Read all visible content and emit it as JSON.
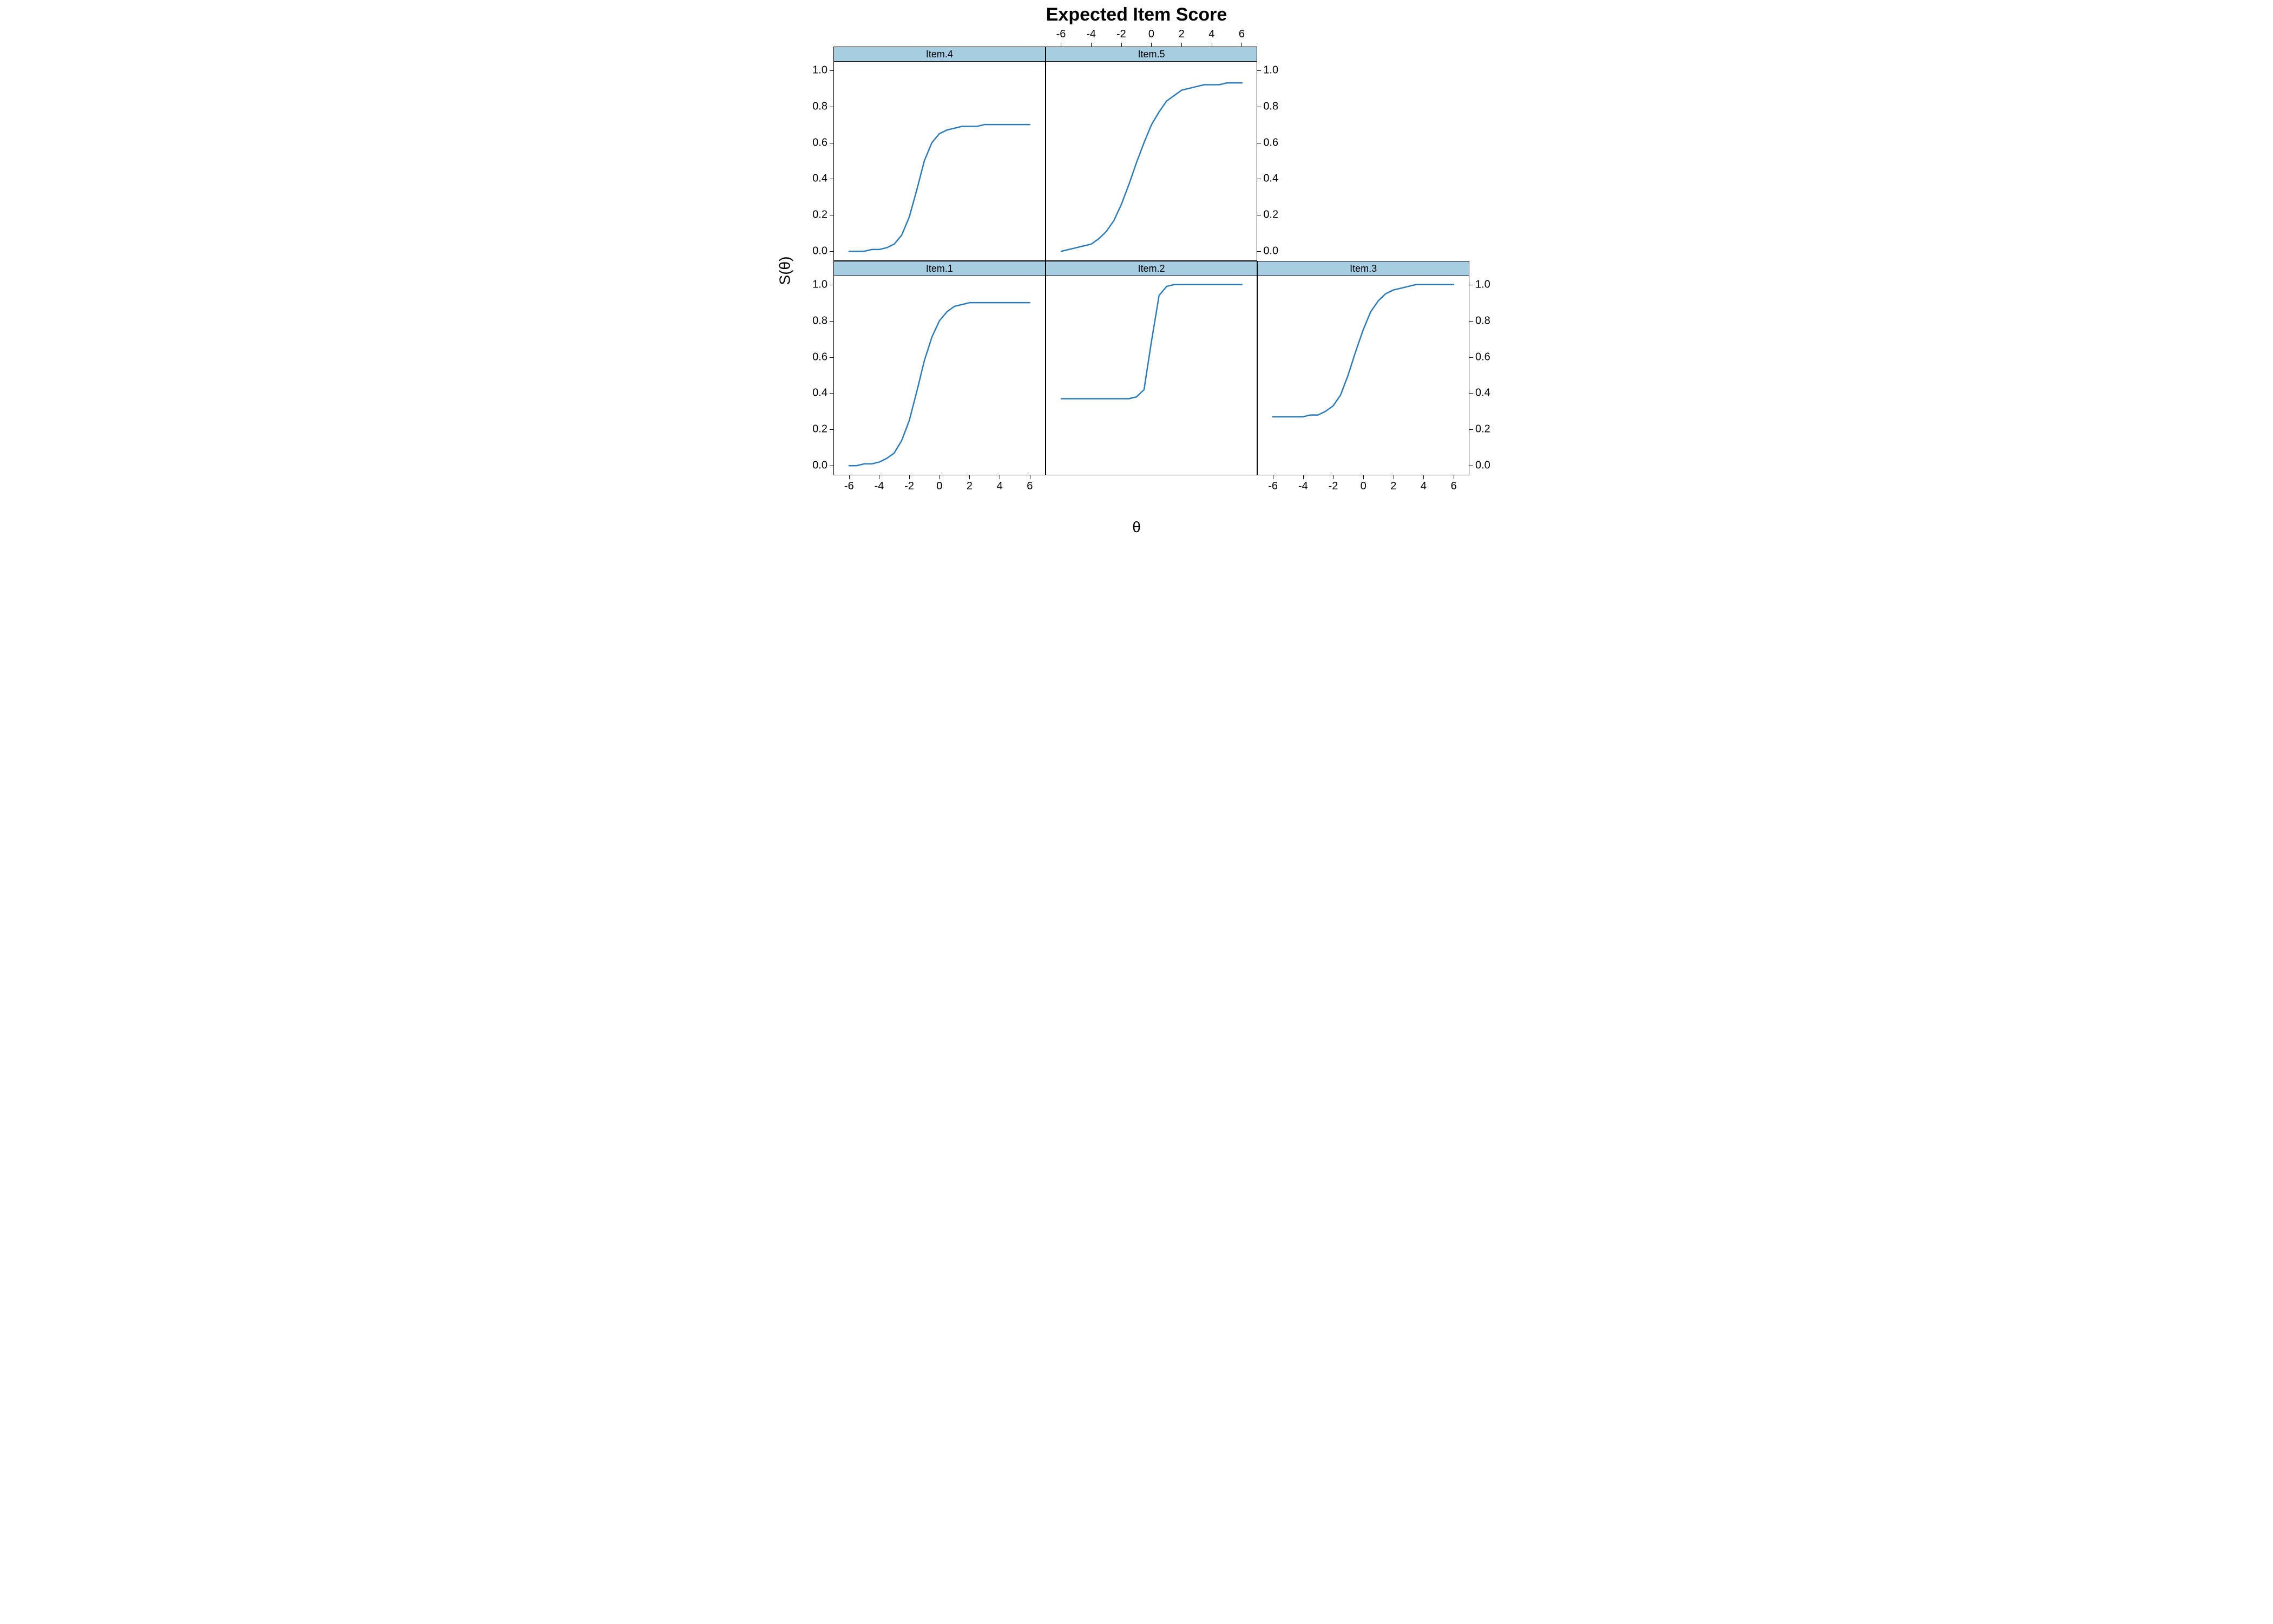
{
  "title": "Expected Item Score",
  "xlabel": "θ",
  "ylabel": "S(θ)",
  "x_ticks": [
    -6,
    -4,
    -2,
    0,
    2,
    4,
    6
  ],
  "y_ticks": [
    0.0,
    0.2,
    0.4,
    0.6,
    0.8,
    1.0
  ],
  "xlim": [
    -7,
    7
  ],
  "ylim": [
    -0.05,
    1.05
  ],
  "panels": {
    "top_left": {
      "label": "Item.4",
      "curve_key": "item4"
    },
    "top_mid": {
      "label": "Item.5",
      "curve_key": "item5"
    },
    "bot_left": {
      "label": "Item.1",
      "curve_key": "item1"
    },
    "bot_mid": {
      "label": "Item.2",
      "curve_key": "item2"
    },
    "bot_right": {
      "label": "Item.3",
      "curve_key": "item3"
    }
  },
  "chart_data": {
    "type": "line",
    "title": "Expected Item Score",
    "xlabel": "θ",
    "ylabel": "S(θ)",
    "xlim": [
      -7,
      7
    ],
    "ylim": [
      -0.05,
      1.05
    ],
    "grid": false,
    "legend": "strip-labels",
    "x": [
      -6,
      -5.5,
      -5,
      -4.5,
      -4,
      -3.5,
      -3,
      -2.5,
      -2,
      -1.5,
      -1,
      -0.5,
      0,
      0.5,
      1,
      1.5,
      2,
      2.5,
      3,
      3.5,
      4,
      4.5,
      5,
      5.5,
      6
    ],
    "series": [
      {
        "name": "Item.1",
        "values": [
          0.0,
          0.0,
          0.01,
          0.01,
          0.02,
          0.04,
          0.07,
          0.14,
          0.25,
          0.41,
          0.58,
          0.71,
          0.8,
          0.85,
          0.88,
          0.89,
          0.9,
          0.9,
          0.9,
          0.9,
          0.9,
          0.9,
          0.9,
          0.9,
          0.9
        ]
      },
      {
        "name": "Item.2",
        "values": [
          0.37,
          0.37,
          0.37,
          0.37,
          0.37,
          0.37,
          0.37,
          0.37,
          0.37,
          0.37,
          0.38,
          0.42,
          0.69,
          0.94,
          0.99,
          1.0,
          1.0,
          1.0,
          1.0,
          1.0,
          1.0,
          1.0,
          1.0,
          1.0,
          1.0
        ]
      },
      {
        "name": "Item.3",
        "values": [
          0.27,
          0.27,
          0.27,
          0.27,
          0.27,
          0.28,
          0.28,
          0.3,
          0.33,
          0.39,
          0.5,
          0.63,
          0.75,
          0.85,
          0.91,
          0.95,
          0.97,
          0.98,
          0.99,
          1.0,
          1.0,
          1.0,
          1.0,
          1.0,
          1.0
        ]
      },
      {
        "name": "Item.4",
        "values": [
          0.0,
          0.0,
          0.0,
          0.01,
          0.01,
          0.02,
          0.04,
          0.09,
          0.19,
          0.34,
          0.5,
          0.6,
          0.65,
          0.67,
          0.68,
          0.69,
          0.69,
          0.69,
          0.7,
          0.7,
          0.7,
          0.7,
          0.7,
          0.7,
          0.7
        ]
      },
      {
        "name": "Item.5",
        "values": [
          0.0,
          0.01,
          0.02,
          0.03,
          0.04,
          0.07,
          0.11,
          0.17,
          0.26,
          0.37,
          0.49,
          0.6,
          0.7,
          0.77,
          0.83,
          0.86,
          0.89,
          0.9,
          0.91,
          0.92,
          0.92,
          0.92,
          0.93,
          0.93,
          0.93
        ]
      }
    ]
  }
}
